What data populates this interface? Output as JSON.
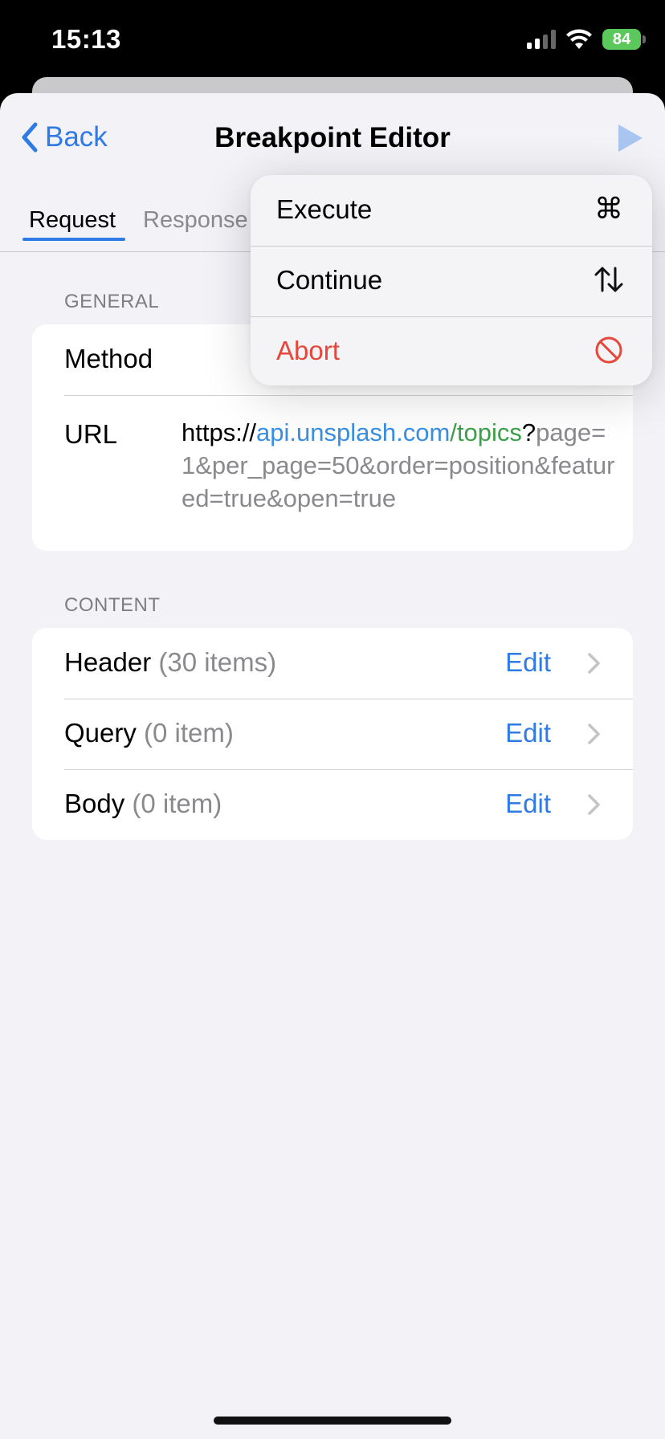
{
  "status_bar": {
    "time": "15:13",
    "battery": "84"
  },
  "nav": {
    "back_label": "Back",
    "title": "Breakpoint Editor"
  },
  "tabs": [
    {
      "label": "Request",
      "active": true
    },
    {
      "label": "Response",
      "active": false
    }
  ],
  "general": {
    "section_label": "GENERAL",
    "method_label": "Method",
    "url_label": "URL",
    "url": {
      "scheme": "https://",
      "host": "api.unsplash.com",
      "path": "/topics",
      "qmark": "?",
      "query": "page=1&per_page=50&order=position&featured=true&open=true"
    }
  },
  "content": {
    "section_label": "CONTENT",
    "edit_label": "Edit",
    "rows": [
      {
        "name": "Header",
        "count": "(30 items)"
      },
      {
        "name": "Query",
        "count": "(0 item)"
      },
      {
        "name": "Body",
        "count": "(0 item)"
      }
    ]
  },
  "menu": {
    "items": [
      {
        "label": "Execute",
        "icon": "command-icon",
        "glyph": "⌘"
      },
      {
        "label": "Continue",
        "icon": "up-down-arrows-icon",
        "glyph": "⇅"
      },
      {
        "label": "Abort",
        "icon": "prohibited-icon",
        "glyph": ""
      }
    ]
  },
  "colors": {
    "accent": "#2f7be6",
    "destructive": "#e5483a",
    "host": "#3a8fe0",
    "path": "#3ea04a"
  }
}
